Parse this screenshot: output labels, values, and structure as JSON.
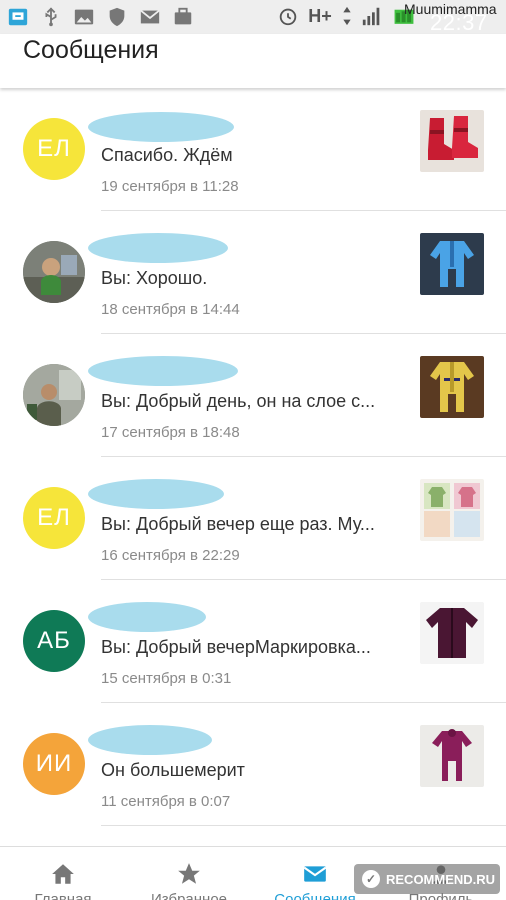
{
  "status_bar": {
    "user": "Muumimamma",
    "time": "22:37",
    "left_icons": [
      "screen-share-icon",
      "usb-icon",
      "image-icon",
      "shield-icon",
      "mail-icon",
      "briefcase-icon"
    ],
    "right_icons": [
      "alarm-icon",
      "network-hplus-icon",
      "data-arrows-icon",
      "signal-icon",
      "battery-icon"
    ],
    "network_label": "H+"
  },
  "header": {
    "title": "Сообщения"
  },
  "conversations": [
    {
      "initials": "ЕЛ",
      "avatar_color": "#f6e53a",
      "avatar_type": "initials",
      "message": "Спасибо. Ждём",
      "date": "19 сентября в 11:28",
      "thumb": "red-boots"
    },
    {
      "initials": "",
      "avatar_color": "#8a8f86",
      "avatar_type": "photo",
      "message": "Вы: Хорошо.",
      "date": "18 сентября в 14:44",
      "thumb": "blue-suit"
    },
    {
      "initials": "",
      "avatar_color": "#9aa095",
      "avatar_type": "photo",
      "message": "Вы: Добрый день, он на слое с...",
      "date": "17 сентября в 18:48",
      "thumb": "yellow-suit"
    },
    {
      "initials": "ЕЛ",
      "avatar_color": "#f6e53a",
      "avatar_type": "initials",
      "message": "Вы: Добрый вечер еще раз. Му...",
      "date": "16 сентября в 22:29",
      "thumb": "baby-clothes"
    },
    {
      "initials": "АБ",
      "avatar_color": "#0f7a56",
      "avatar_type": "initials",
      "message": "Вы: Добрый вечерМаркировка...",
      "date": "15 сентября в 0:31",
      "thumb": "dark-jacket"
    },
    {
      "initials": "ИИ",
      "avatar_color": "#f4a43a",
      "avatar_type": "initials",
      "message": "Он большемерит",
      "date": "11 сентября в 0:07",
      "thumb": "purple-suit"
    }
  ],
  "bottom_nav": [
    {
      "label": "Главная",
      "icon": "home-icon",
      "active": false
    },
    {
      "label": "Избранное",
      "icon": "star-icon",
      "active": false
    },
    {
      "label": "Сообщения",
      "icon": "mail-icon",
      "active": true
    },
    {
      "label": "Профиль",
      "icon": "profile-icon",
      "active": false
    }
  ],
  "watermark": "RECOMMEND.RU",
  "colors": {
    "accent": "#1f9ed6",
    "name_blur": "#a9dced"
  }
}
